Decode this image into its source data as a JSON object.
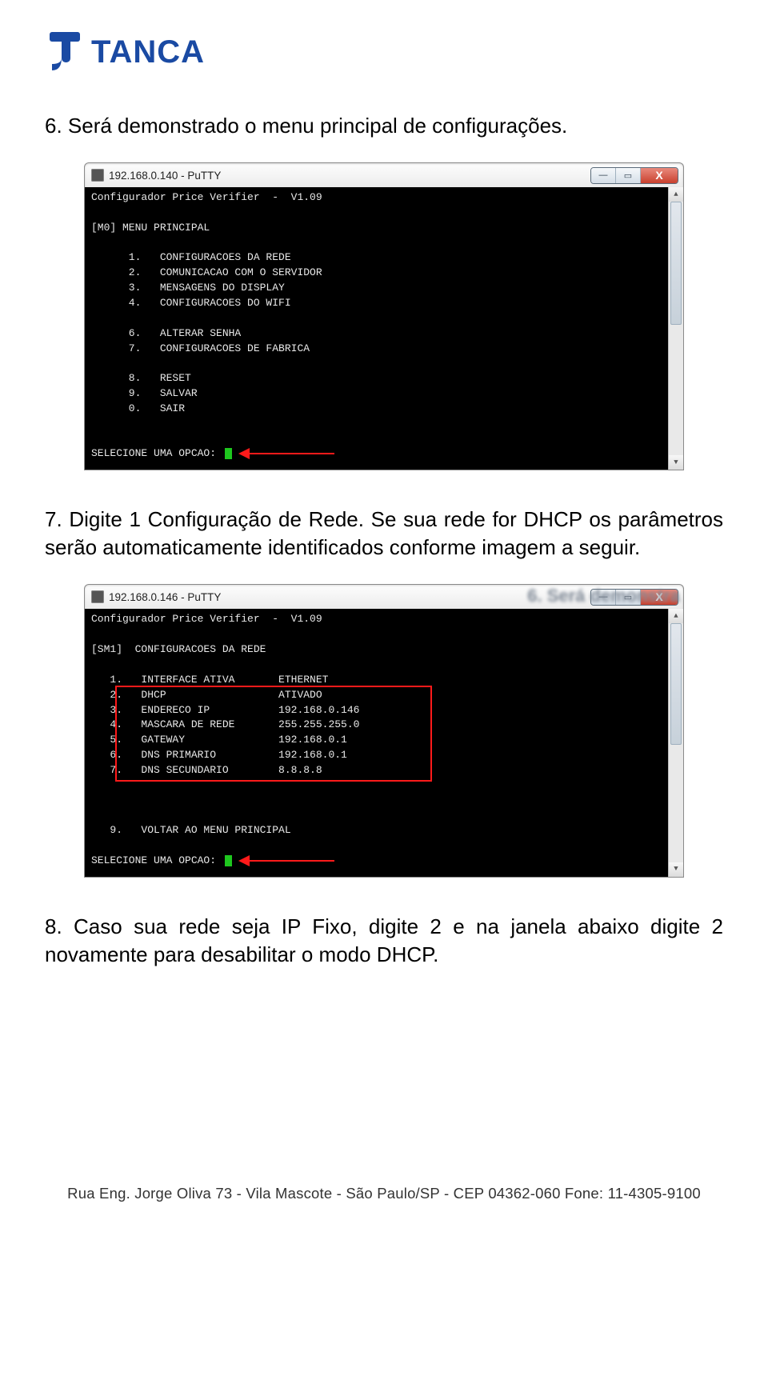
{
  "header": {
    "brand": "TANCA"
  },
  "p1": "6. Será demonstrado o menu principal de configurações.",
  "p2": "7. Digite 1 Configuração de Rede. Se sua rede for DHCP os parâmetros serão automaticamente identificados conforme imagem a seguir.",
  "p3": "8. Caso sua rede seja IP Fixo, digite 2 e na janela abaixo digite 2 novamente para desabilitar o modo DHCP.",
  "footer": "Rua Eng. Jorge Oliva 73 - Vila Mascote - São Paulo/SP - CEP 04362-060 Fone: 11-4305-9100",
  "win1": {
    "title": "192.168.0.140 - PuTTY",
    "header": "Configurador Price Verifier  -  V1.09",
    "menu_title": "[M0] MENU PRINCIPAL",
    "items": [
      "      1.   CONFIGURACOES DA REDE",
      "      2.   COMUNICACAO COM O SERVIDOR",
      "      3.   MENSAGENS DO DISPLAY",
      "      4.   CONFIGURACOES DO WIFI",
      "",
      "      6.   ALTERAR SENHA",
      "      7.   CONFIGURACOES DE FABRICA",
      "",
      "      8.   RESET",
      "      9.   SALVAR",
      "      0.   SAIR"
    ],
    "prompt": "SELECIONE UMA OPCAO: "
  },
  "win2": {
    "title": "192.168.0.146 - PuTTY",
    "bg_text": "6.  Será demonstra",
    "header": "Configurador Price Verifier  -  V1.09",
    "menu_title": "[SM1]  CONFIGURACOES DA REDE",
    "rows": [
      {
        "n": "1.",
        "k": "INTERFACE ATIVA",
        "v": "ETHERNET"
      },
      {
        "n": "2.",
        "k": "DHCP",
        "v": "ATIVADO"
      },
      {
        "n": "3.",
        "k": "ENDERECO IP",
        "v": "192.168.0.146"
      },
      {
        "n": "4.",
        "k": "MASCARA DE REDE",
        "v": "255.255.255.0"
      },
      {
        "n": "5.",
        "k": "GATEWAY",
        "v": "192.168.0.1"
      },
      {
        "n": "6.",
        "k": "DNS PRIMARIO",
        "v": "192.168.0.1"
      },
      {
        "n": "7.",
        "k": "DNS SECUNDARIO",
        "v": "8.8.8.8"
      }
    ],
    "back": "   9.   VOLTAR AO MENU PRINCIPAL",
    "prompt": "SELECIONE UMA OPCAO: "
  }
}
